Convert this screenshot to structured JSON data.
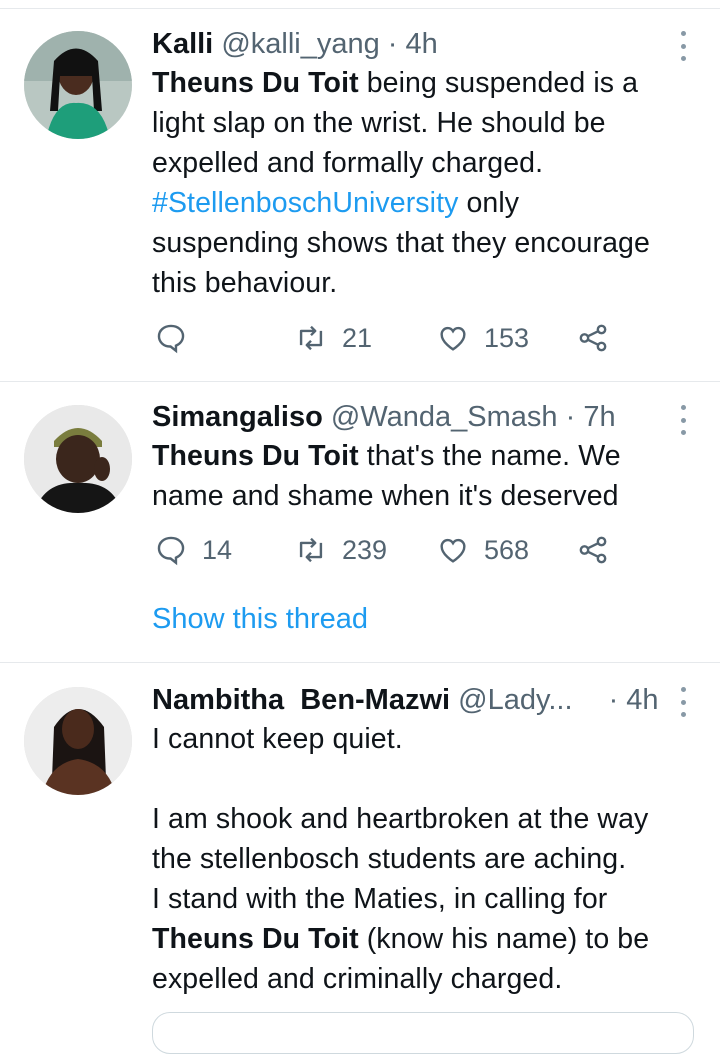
{
  "tweets": [
    {
      "name": "Kalli",
      "handle": "@kalli_yang",
      "sep": "·",
      "time": "4h",
      "body": {
        "line1_bold": "Theuns Du Toit",
        "line1_rest": " being suspended is a",
        "line2": "light slap on the wrist. He should be",
        "line3": "expelled and formally charged.",
        "hashtag": "#StellenboschUniversity",
        "line4_rest": " only",
        "line5": "suspending shows that they encourage",
        "line6": "this behaviour."
      },
      "actions": {
        "reply": "",
        "retweet": "21",
        "like": "153"
      }
    },
    {
      "name": "Simangaliso",
      "handle": "@Wanda_Smash",
      "sep": "·",
      "time": "7h",
      "body": {
        "line1_bold": "Theuns Du Toit",
        "line1_rest": " that's the name. We",
        "line2": "name and shame when it's deserved"
      },
      "actions": {
        "reply": "14",
        "retweet": "239",
        "like": "568"
      },
      "show_thread": "Show this thread"
    },
    {
      "name": "Nambitha  Ben-Mazwi",
      "handle": "@Lady...",
      "sep": "·",
      "time": "4h",
      "body": {
        "line1": "I cannot keep quiet.",
        "line2": "I am shook and heartbroken at the way",
        "line3": "the stellenbosch students are aching.",
        "line4": "I stand with the Maties, in calling for",
        "line5_bold": "Theuns Du Toit",
        "line5_rest": " (know his name) to be",
        "line6": "expelled and criminally charged."
      }
    }
  ],
  "colors": {
    "accent": "#1d9bf0",
    "muted": "#536471",
    "text": "#0f1419"
  },
  "icons": [
    "reply-icon",
    "retweet-icon",
    "like-icon",
    "share-icon",
    "more-icon"
  ]
}
